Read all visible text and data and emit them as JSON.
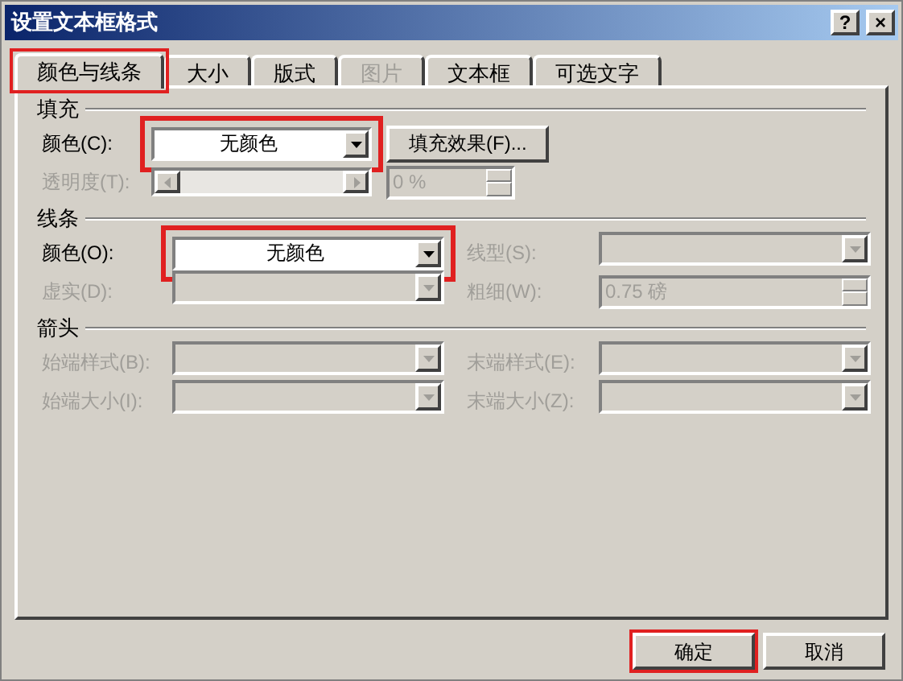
{
  "window": {
    "title": "设置文本框格式",
    "controls": [
      {
        "kind": "help",
        "label": "?"
      },
      {
        "kind": "close",
        "label": "×"
      }
    ]
  },
  "tabs": [
    {
      "label": "颜色与线条",
      "selected": true,
      "disabled": false,
      "highlighted": true
    },
    {
      "label": "大小",
      "selected": false,
      "disabled": false,
      "highlighted": false
    },
    {
      "label": "版式",
      "selected": false,
      "disabled": false,
      "highlighted": false
    },
    {
      "label": "图片",
      "selected": false,
      "disabled": true,
      "highlighted": false
    },
    {
      "label": "文本框",
      "selected": false,
      "disabled": false,
      "highlighted": false
    },
    {
      "label": "可选文字",
      "selected": false,
      "disabled": false,
      "highlighted": false
    }
  ],
  "sections": [
    {
      "title": "填充",
      "kind": "narrow",
      "rows": [
        [
          {
            "kind": "dropdown",
            "label": "颜色(C):",
            "value": "无颜色",
            "disabled": false,
            "highlighted": true
          },
          {
            "kind": "button",
            "label": "填充效果(F)...",
            "disabled": false,
            "highlighted": false
          }
        ],
        [
          {
            "kind": "slider",
            "label": "透明度(T):",
            "level": 0,
            "disabled": true,
            "highlighted": false
          },
          {
            "kind": "spinner",
            "value": "0 %",
            "disabled": true,
            "highlighted": false
          }
        ]
      ]
    },
    {
      "title": "线条",
      "kind": "wide",
      "rows": [
        [
          {
            "kind": "dropdown",
            "label": "颜色(O):",
            "value": "无颜色",
            "disabled": false,
            "highlighted": true
          },
          {
            "kind": "dropdown",
            "label": "线型(S):",
            "disabled": true,
            "highlighted": false
          }
        ],
        [
          {
            "kind": "dropdown",
            "label": "虚实(D):",
            "disabled": true,
            "highlighted": false
          },
          {
            "kind": "spinner",
            "label": "粗细(W):",
            "value": "0.75 磅",
            "disabled": true,
            "highlighted": false
          }
        ]
      ]
    },
    {
      "title": "箭头",
      "kind": "wide",
      "rows": [
        [
          {
            "kind": "dropdown",
            "label": "始端样式(B):",
            "disabled": true,
            "highlighted": false
          },
          {
            "kind": "dropdown",
            "label": "末端样式(E):",
            "disabled": true,
            "highlighted": false
          }
        ],
        [
          {
            "kind": "dropdown",
            "label": "始端大小(I):",
            "disabled": true,
            "highlighted": false
          },
          {
            "kind": "dropdown",
            "label": "末端大小(Z):",
            "disabled": true,
            "highlighted": false
          }
        ]
      ]
    }
  ],
  "buttons": [
    {
      "label": "确定",
      "highlighted": true
    },
    {
      "label": "取消",
      "highlighted": false
    }
  ]
}
